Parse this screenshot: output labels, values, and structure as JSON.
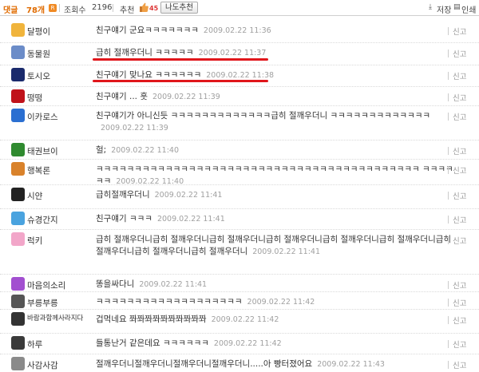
{
  "header": {
    "reply_label": "댓글",
    "reply_count": "78개",
    "rss_label": "R",
    "views_label": "조회수",
    "views_count": "2196",
    "recommend_label": "추천",
    "recommend_count": "45",
    "recommend_button": "나도추천",
    "save_label": "저장",
    "print_label": "인쇄"
  },
  "report_label": "신고",
  "comments": [
    {
      "nick": "달평이",
      "text": "친구얘기 군요ㅋㅋㅋㅋㅋㅋㅋ",
      "date": "2009.02.22 11:36",
      "avatar_color": "#f0b43c",
      "avatar": "smile-face-icon"
    },
    {
      "nick": "동물원",
      "text": "급히 절깨우더니 ㅋㅋㅋㅋㅋ",
      "date": "2009.02.22 11:37",
      "avatar_color": "#6b8cc8",
      "avatar": "phone-icon"
    },
    {
      "nick": "토시오",
      "text": "친구얘기 맞나요 ㅋㅋㅋㅋㅋㅋ",
      "date": "2009.02.22 11:38",
      "avatar_color": "#1a2a6c",
      "avatar": "ghost-icon"
    },
    {
      "nick": "떵떵",
      "text": "친구얘기 ... 훗",
      "date": "2009.02.22 11:39",
      "avatar_color": "#c0121a",
      "avatar": "lips-icon"
    },
    {
      "nick": "이카로스",
      "text": "친구얘기가 아니신듯 ㅋㅋㅋㅋㅋㅋㅋㅋㅋㅋㅋㅋㅋ급히 절깨우더니 ㅋㅋㅋㅋㅋㅋㅋㅋㅋㅋㅋㅋㅋ",
      "date": "2009.02.22 11:39",
      "avatar_color": "#2b6fd1",
      "avatar": "music-note-icon"
    },
    {
      "nick": "태권브이",
      "text": "헐;",
      "date": "2009.02.22 11:40",
      "avatar_color": "#2f8a2f",
      "avatar": "text-badge-icon"
    },
    {
      "nick": "행복론",
      "text": "ㅋㅋㅋㅋㅋㅋㅋㅋㅋㅋㅋㅋㅋㅋㅋㅋㅋㅋㅋㅋㅋㅋㅋㅋㅋㅋㅋㅋㅋㅋㅋㅋㅋㅋㅋㅋㅋㅋㅋㅋㅋㅋ ㅋㅋㅋㅋㅋㅋ",
      "date": "2009.02.22 11:40",
      "avatar_color": "#d9822b",
      "avatar": "boy-face-icon"
    },
    {
      "nick": "시얀",
      "text": "급히절깨우더니",
      "date": "2009.02.22 11:41",
      "avatar_color": "#222222",
      "avatar": "silhouette-icon"
    },
    {
      "nick": "슈경간지",
      "text": "친구얘기 ㅋㅋㅋ",
      "date": "2009.02.22 11:41",
      "avatar_color": "#4aa3df",
      "avatar": "snowflake-icon"
    },
    {
      "nick": "럭키",
      "text": "급히 절깨우더니급히 절깨우더니급히 절깨우더니급히 절깨우더니급히 절깨우더니급히 절깨우더니급히 절깨우더니급히 절깨우더니급히 절깨우더니",
      "date": "2009.02.22 11:41",
      "avatar_color": "#f2a6c9",
      "avatar": "rabbit-icon"
    },
    {
      "nick": "마음의소리",
      "text": "똥을싸다니",
      "date": "2009.02.22 11:41",
      "avatar_color": "#a24fd0",
      "avatar": "purple-bubble-icon"
    },
    {
      "nick": "부릉부릉",
      "text": "ㅋㅋㅋㅋㅋㅋㅋㅋㅋㅋㅋㅋㅋㅋㅋㅋㅋㅋㅋ",
      "date": "2009.02.22 11:42",
      "avatar_color": "#555555",
      "avatar": "car-icon"
    },
    {
      "nick": "바람과함께사라지다",
      "text": "겁먹네요 쫘쫘쫘쫘쫘쫘쫘쫘쫘쫘",
      "date": "2009.02.22 11:42",
      "avatar_color": "#333333",
      "avatar": "figure-icon"
    },
    {
      "nick": "하루",
      "text": "들통난거 같은데요 ㅋㅋㅋㅋㅋㅋ",
      "date": "2009.02.22 11:42",
      "avatar_color": "#3a3a3a",
      "avatar": "paw-icon"
    },
    {
      "nick": "사감사감",
      "text": "절깨우더니절깨우더니절깨우더니절깨우더니.....아 빵터졌어요",
      "date": "2009.02.22 11:43",
      "avatar_color": "#8a8a8a",
      "avatar": "face-icon"
    }
  ]
}
